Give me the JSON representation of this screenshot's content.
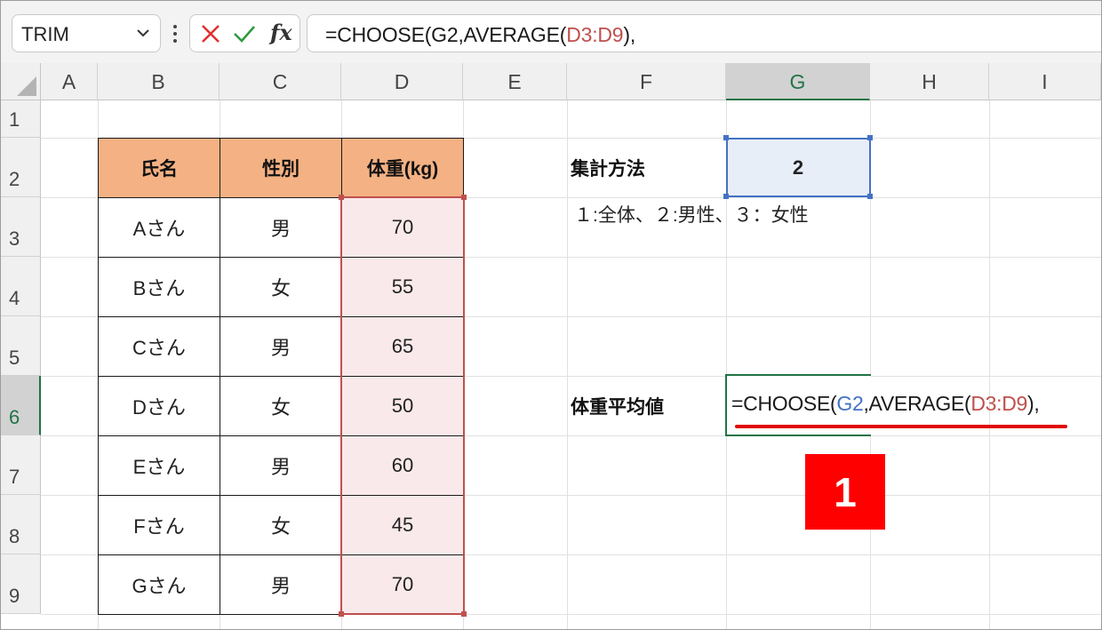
{
  "formula_bar": {
    "name_box": "TRIM",
    "formula_parts": [
      "=CHOOSE(G2,AVERAGE(",
      "D3:D9",
      "),"
    ],
    "fx_label": "fx"
  },
  "columns": [
    "A",
    "B",
    "C",
    "D",
    "E",
    "F",
    "G",
    "H",
    "I"
  ],
  "rows": [
    "1",
    "2",
    "3",
    "4",
    "5",
    "6",
    "7",
    "8",
    "9"
  ],
  "selected_column": "G",
  "selected_row": "6",
  "table": {
    "headers": [
      "氏名",
      "性別",
      "体重(kg)"
    ],
    "rows": [
      [
        "Aさん",
        "男",
        "70"
      ],
      [
        "Bさん",
        "女",
        "55"
      ],
      [
        "Cさん",
        "男",
        "65"
      ],
      [
        "Dさん",
        "女",
        "50"
      ],
      [
        "Eさん",
        "男",
        "60"
      ],
      [
        "Fさん",
        "女",
        "45"
      ],
      [
        "Gさん",
        "男",
        "70"
      ]
    ]
  },
  "method": {
    "label": "集計方法",
    "value": "2",
    "note": "１:全体、２:男性、３：女性"
  },
  "average": {
    "label": "体重平均値",
    "parts": [
      "=CHOOSE(",
      "G2",
      ",AVERAGE(",
      "D3:D9",
      "),"
    ]
  },
  "step_badge": "1",
  "colors": {
    "header_fill": "#f4b183",
    "range_red": "#c0504d",
    "range_blue": "#4472c4",
    "excel_green": "#217346",
    "badge_red": "#ff0000"
  }
}
